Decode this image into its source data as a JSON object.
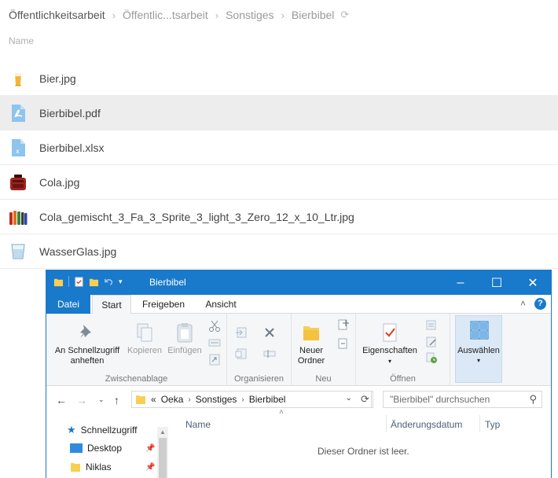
{
  "breadcrumb": {
    "items": [
      "Öffentlichkeitsarbeit",
      "Öffentlic...tsarbeit",
      "Sonstiges",
      "Bierbibel"
    ],
    "separator": "›"
  },
  "list": {
    "column_name": "Name",
    "files": [
      {
        "name": "Bier.jpg",
        "icon": "beer-glass-icon",
        "highlighted": false
      },
      {
        "name": "Bierbibel.pdf",
        "icon": "pdf-file-icon",
        "highlighted": true
      },
      {
        "name": "Bierbibel.xlsx",
        "icon": "excel-file-icon",
        "highlighted": false
      },
      {
        "name": "Cola.jpg",
        "icon": "cola-crate-icon",
        "highlighted": false
      },
      {
        "name": "Cola_gemischt_3_Fa_3_Sprite_3_light_3_Zero_12_x_10_Ltr.jpg",
        "icon": "bottles-icon",
        "highlighted": false
      },
      {
        "name": "WasserGlas.jpg",
        "icon": "water-glass-icon",
        "highlighted": false
      }
    ]
  },
  "explorer": {
    "title": "Bierbibel",
    "tabs": {
      "file": "Datei",
      "start": "Start",
      "share": "Freigeben",
      "view": "Ansicht"
    },
    "ribbon": {
      "pin_quick_access": "An Schnellzugriff anheften",
      "copy": "Kopieren",
      "paste": "Einfügen",
      "clipboard_group": "Zwischenablage",
      "organize_group": "Organisieren",
      "new_folder": "Neuer Ordner",
      "new_group": "Neu",
      "properties": "Eigenschaften",
      "open_group": "Öffnen",
      "select": "Auswählen"
    },
    "address": {
      "overflow": "«",
      "segments": [
        "Oeka",
        "Sonstiges",
        "Bierbibel"
      ]
    },
    "search_placeholder": "\"Bierbibel\" durchsuchen",
    "nav_pane": {
      "quick_access": "Schnellzugriff",
      "desktop": "Desktop",
      "niklas": "Niklas"
    },
    "columns": {
      "name": "Name",
      "date": "Änderungsdatum",
      "type": "Typ"
    },
    "empty_message": "Dieser Ordner ist leer."
  },
  "colors": {
    "accent": "#1979ca",
    "row_highlight": "#ededed",
    "folder": "#f7cf55"
  }
}
